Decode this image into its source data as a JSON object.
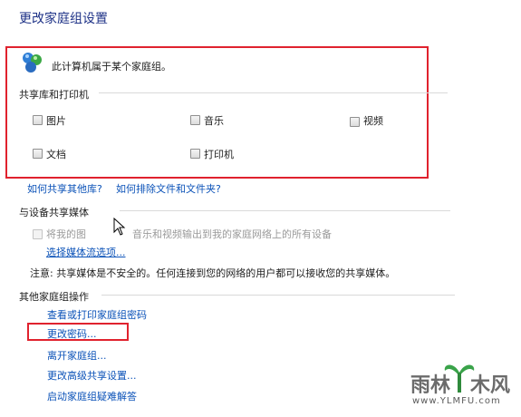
{
  "page_title": "更改家庭组设置",
  "homegroup_status": "此计算机属于某个家庭组。",
  "libraries": {
    "heading": "共享库和打印机",
    "items": [
      {
        "label": "图片",
        "checked": false
      },
      {
        "label": "音乐",
        "checked": false
      },
      {
        "label": "视频",
        "checked": false
      },
      {
        "label": "文档",
        "checked": false
      },
      {
        "label": "打印机",
        "checked": false
      }
    ]
  },
  "links_row": {
    "share_other": "如何共享其他库?",
    "exclude": "如何排除文件和文件夹?"
  },
  "media": {
    "heading": "与设备共享媒体",
    "stream_label_part1": "将我的图",
    "stream_label_part2": "音乐和视频输出到我的家庭网络上的所有设备",
    "choose_options": "选择媒体流选项...",
    "note": "注意: 共享媒体是不安全的。任何连接到您的网络的用户都可以接收您的共享媒体。"
  },
  "other_actions": {
    "heading": "其他家庭组操作",
    "items": [
      "查看或打印家庭组密码",
      "更改密码...",
      "离开家庭组...",
      "更改高级共享设置...",
      "启动家庭组疑难解答"
    ]
  },
  "watermark": {
    "brand_left": "雨林",
    "brand_right": "木风",
    "url": "www.YLMFU.com"
  },
  "colors": {
    "accent_red": "#e0222e",
    "link_blue": "#0b52b8",
    "title_blue": "#1e3287"
  }
}
